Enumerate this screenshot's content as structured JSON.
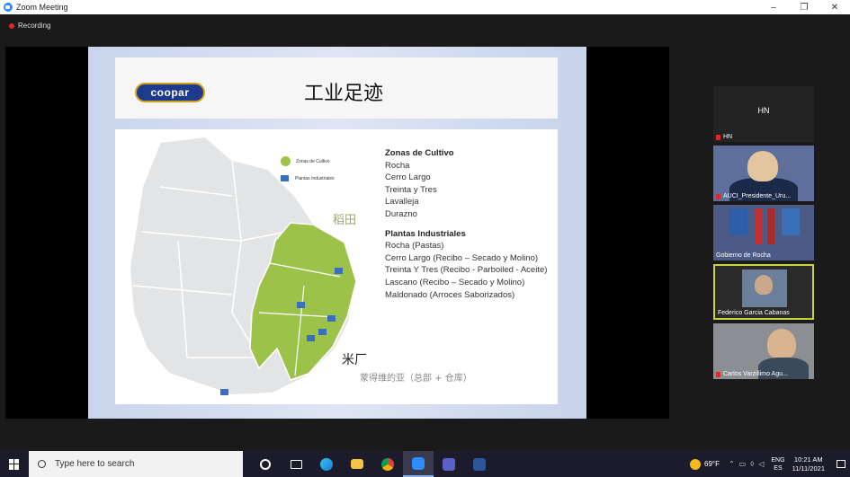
{
  "window": {
    "title": "Zoom Meeting",
    "minimize": "–",
    "maximize": "❐",
    "close": "✕"
  },
  "meeting": {
    "recording_label": "Recording"
  },
  "slide": {
    "logo_text": "coopar",
    "title": "工业足迹",
    "legend": {
      "green": "Zonas de Cultivo",
      "blue": "Plantas Industriales"
    },
    "labels": {
      "rice": "稻田",
      "mill": "米厂",
      "hq": "蒙得维的亚（总部 + 仓库）"
    },
    "zonas_heading": "Zonas de Cultivo",
    "zonas": [
      "Rocha",
      "Cerro Largo",
      "Treinta y Tres",
      "Lavalleja",
      "Durazno"
    ],
    "plantas_heading": "Plantas Industriales",
    "plantas": [
      "Rocha (Pastas)",
      "Cerro Largo (Recibo – Secado y Molino)",
      "Treinta Y Tres (Recibo - Parboiled - Aceite)",
      "Lascano (Recibo – Secado y Molino)",
      "Maldonado (Arroces Saborizados)"
    ],
    "colors": {
      "green_region": "#9cc24a",
      "map_gray": "#e2e4e6",
      "factory": "#3a6ec0"
    }
  },
  "participants": [
    {
      "name": "HN",
      "tile_label": "HN",
      "muted": true
    },
    {
      "name": "AUCI_Presidente_Uru...",
      "muted": true
    },
    {
      "name": "Gobierno de Rocha",
      "muted": false
    },
    {
      "name": "Federico Garcia Cabanas",
      "muted": false,
      "active_speaker": true
    },
    {
      "name": "Carlos Varzillimo Agu...",
      "muted": true
    }
  ],
  "taskbar": {
    "search_placeholder": "Type here to search",
    "weather": "69°F",
    "lang_top": "ENG",
    "lang_bottom": "ES",
    "time": "10:21 AM",
    "date": "11/11/2021"
  }
}
